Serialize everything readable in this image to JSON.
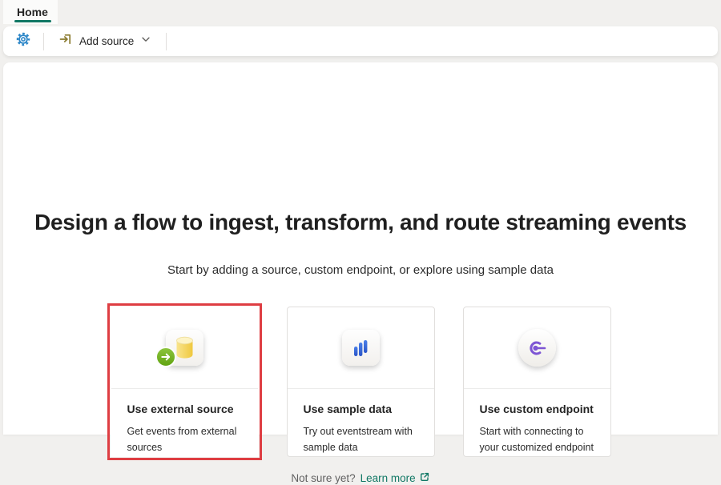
{
  "tabs": [
    {
      "label": "Home",
      "active": true
    }
  ],
  "toolbar": {
    "add_source_label": "Add source"
  },
  "hero": {
    "title": "Design a flow to ingest, transform, and route streaming events",
    "subtitle": "Start by adding a source, custom endpoint, or explore using sample data"
  },
  "cards": [
    {
      "title": "Use external source",
      "description": "Get events from external sources",
      "icon": "database-with-arrow-icon",
      "highlighted": true
    },
    {
      "title": "Use sample data",
      "description": "Try out eventstream with sample data",
      "icon": "bar-chart-icon",
      "highlighted": false
    },
    {
      "title": "Use custom endpoint",
      "description": "Start with connecting to your customized endpoint",
      "icon": "endpoint-connector-icon",
      "highlighted": false
    }
  ],
  "footer": {
    "prompt": "Not sure yet?",
    "link_label": "Learn more"
  },
  "colors": {
    "accent_teal": "#117865",
    "highlight_red": "#de3d42",
    "gear_blue": "#2e87c8",
    "import_olive": "#8a7b2f",
    "bar_blue": "#3566d6",
    "endpoint_purple": "#7d55d4",
    "database_yellow": "#f2ca3e",
    "badge_green": "#6fae21",
    "page_background": "#f1f0ee"
  }
}
